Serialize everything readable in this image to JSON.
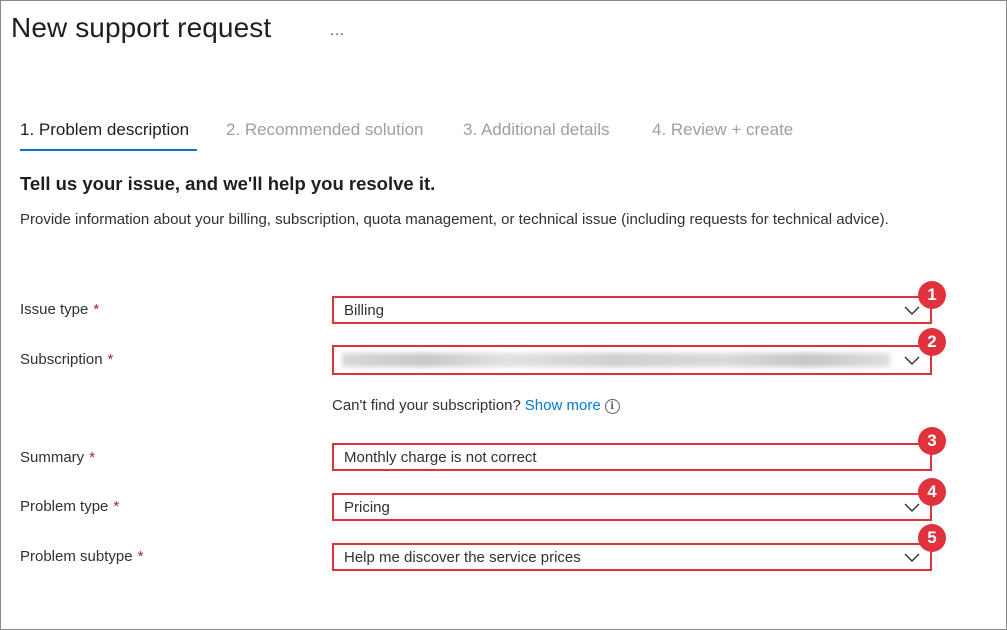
{
  "page": {
    "title": "New support request",
    "more_icon": "…"
  },
  "tabs": [
    {
      "label": "1. Problem description",
      "active": true
    },
    {
      "label": "2. Recommended solution",
      "active": false
    },
    {
      "label": "3. Additional details",
      "active": false
    },
    {
      "label": "4. Review + create",
      "active": false
    }
  ],
  "section": {
    "heading": "Tell us your issue, and we'll help you resolve it.",
    "description": "Provide information about your billing, subscription, quota management, or technical issue (including requests for technical advice)."
  },
  "form": {
    "required_marker": "*",
    "issue_type": {
      "label": "Issue type",
      "value": "Billing",
      "badge": "1"
    },
    "subscription": {
      "label": "Subscription",
      "value_blurred": true,
      "badge": "2"
    },
    "helper": {
      "text": "Can't find your subscription?",
      "link": "Show more",
      "info_icon": "i"
    },
    "summary": {
      "label": "Summary",
      "value": "Monthly charge is not correct",
      "badge": "3"
    },
    "problem_type": {
      "label": "Problem type",
      "value": "Pricing",
      "badge": "4"
    },
    "problem_subtype": {
      "label": "Problem subtype",
      "value": "Help me discover the service prices",
      "badge": "5"
    }
  },
  "colors": {
    "accent": "#0078d4",
    "highlight": "#e0323c",
    "required": "#a4262c"
  }
}
